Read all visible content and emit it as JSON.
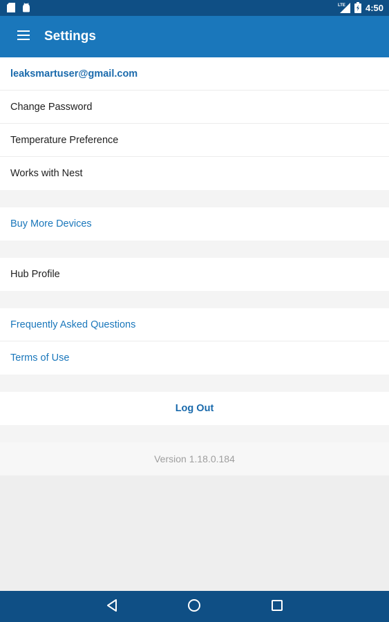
{
  "status_bar": {
    "time": "4:50",
    "network_label": "LTE",
    "icons": [
      "sd-card-icon",
      "android-icon",
      "signal-icon",
      "battery-icon"
    ]
  },
  "app_bar": {
    "title": "Settings",
    "menu_icon": "hamburger-menu-icon"
  },
  "account": {
    "email": "leaksmartuser@gmail.com",
    "items": [
      {
        "label": "Change Password"
      },
      {
        "label": "Temperature Preference"
      },
      {
        "label": "Works with Nest"
      }
    ]
  },
  "shop": {
    "buy_more_devices": "Buy More Devices"
  },
  "hub": {
    "hub_profile": "Hub Profile"
  },
  "help": {
    "faq": "Frequently Asked Questions",
    "terms": "Terms of Use"
  },
  "logout_label": "Log Out",
  "version_text": "Version 1.18.0.184",
  "nav_bar": {
    "icons": [
      "back-icon",
      "home-icon",
      "recents-icon"
    ]
  },
  "colors": {
    "app_bar": "#1a77bb",
    "status_bar": "#0f4f85",
    "link": "#1a77bb",
    "background": "#eeeeee"
  }
}
